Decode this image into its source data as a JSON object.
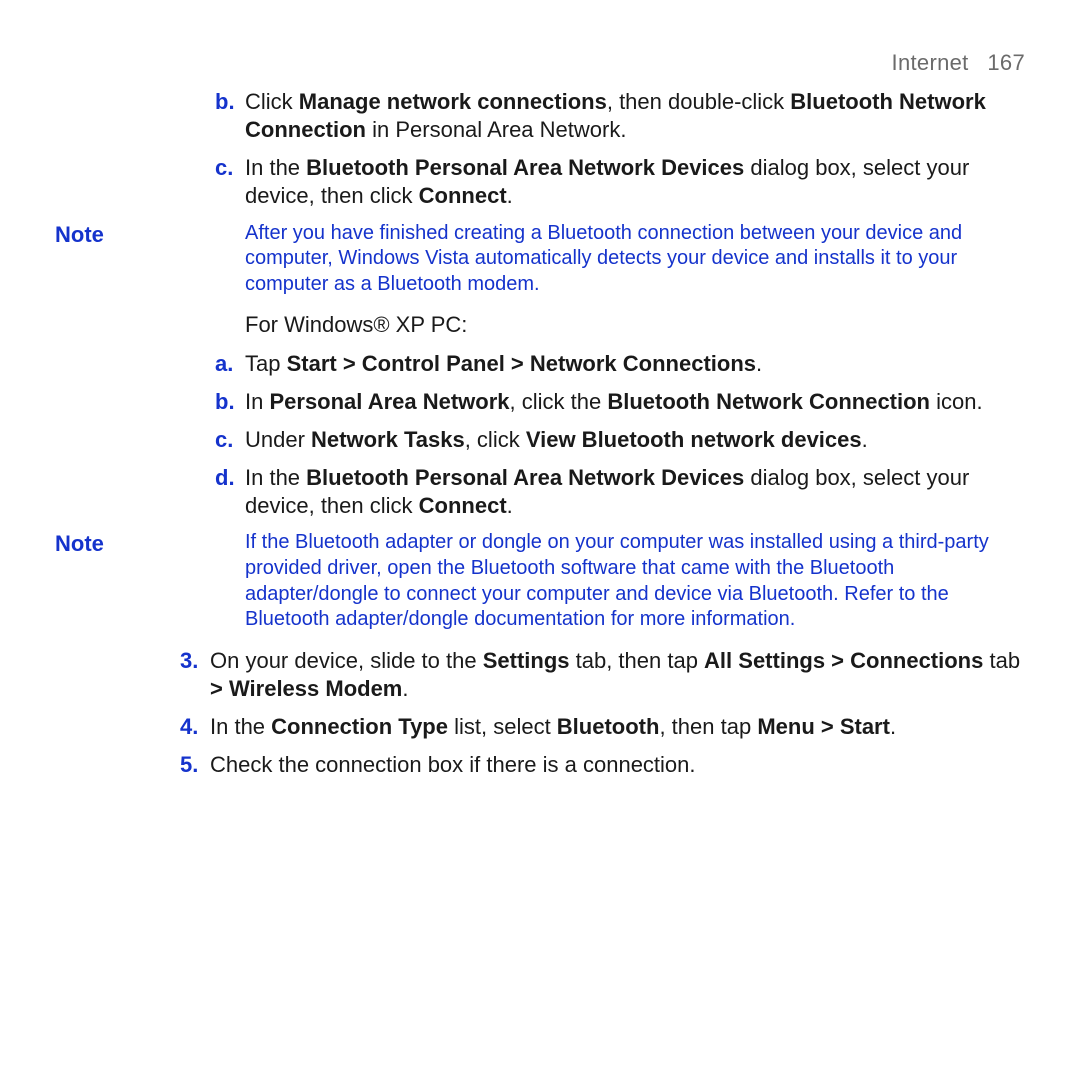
{
  "header": {
    "section": "Internet",
    "page": "167"
  },
  "list1": {
    "b": {
      "marker": "b.",
      "pre": "Click ",
      "s1": "Manage network connections",
      "mid1": ", then double-click ",
      "s2": "Bluetooth Network Connection",
      "post": " in Personal Area Network."
    },
    "c": {
      "marker": "c.",
      "pre": "In the ",
      "s1": "Bluetooth Personal Area Network Devices",
      "mid1": " dialog box, select your device, then click ",
      "s2": "Connect",
      "post": "."
    }
  },
  "note1": {
    "label": "Note",
    "text": "After you have finished creating a Bluetooth connection between your device and computer, Windows Vista automatically detects your device and installs it to your computer as a Bluetooth modem."
  },
  "xpIntro": "For Windows® XP PC:",
  "list2": {
    "a": {
      "marker": "a.",
      "pre": "Tap ",
      "s1": "Start > Control Panel > Network Connections",
      "post": "."
    },
    "b": {
      "marker": "b.",
      "pre": "In ",
      "s1": "Personal Area Network",
      "mid1": ", click the ",
      "s2": "Bluetooth Network Connection",
      "post": " icon."
    },
    "c": {
      "marker": "c.",
      "pre": "Under ",
      "s1": "Network Tasks",
      "mid1": ", click ",
      "s2": "View Bluetooth network devices",
      "post": "."
    },
    "d": {
      "marker": "d.",
      "pre": "In the ",
      "s1": "Bluetooth Personal Area Network Devices",
      "mid1": " dialog box, select your device, then click ",
      "s2": "Connect",
      "post": "."
    }
  },
  "note2": {
    "label": "Note",
    "text": "If the Bluetooth adapter or dongle on your computer was installed using a third-party provided driver, open the Bluetooth software that came with the Bluetooth adapter/dongle to connect your computer and device via Bluetooth. Refer to the Bluetooth adapter/dongle documentation for more information."
  },
  "list3": {
    "s3": {
      "marker": "3.",
      "pre": "On your device, slide to the ",
      "s1": "Settings",
      "mid1": " tab, then tap ",
      "s2": "All Settings > Connections",
      "mid2": " tab ",
      "s3": "> Wireless Modem",
      "post": "."
    },
    "s4": {
      "marker": "4.",
      "pre": "In the ",
      "s1": "Connection Type",
      "mid1": " list, select ",
      "s2": "Bluetooth",
      "mid2": ", then tap ",
      "s3": "Menu > Start",
      "post": "."
    },
    "s5": {
      "marker": "5.",
      "text": "Check the connection box if there is a connection."
    }
  }
}
